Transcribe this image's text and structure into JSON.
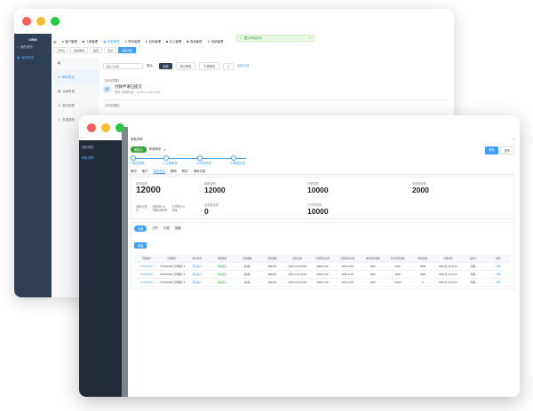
{
  "colors": {
    "red": "#ff5f57",
    "yellow": "#febc2e",
    "green": "#28c840",
    "accent": "#409eff",
    "sidebar_back": "#2f3f56",
    "sidebar_front": "#222b38"
  },
  "back": {
    "brand": "CRM",
    "side_items": [
      {
        "icon": "home-icon",
        "label": "我的首页"
      },
      {
        "icon": "grid-icon",
        "label": "我的审批"
      }
    ],
    "topnav": [
      {
        "icon": "user-icon",
        "label": "客户管理"
      },
      {
        "icon": "doc-icon",
        "label": "工单管理"
      },
      {
        "icon": "check-icon",
        "label": "审批管理"
      },
      {
        "icon": "chart-icon",
        "label": "财务管理"
      },
      {
        "icon": "target-icon",
        "label": "目标管理"
      },
      {
        "icon": "book-icon",
        "label": "办公管理"
      },
      {
        "icon": "box-icon",
        "label": "商品管理"
      },
      {
        "icon": "search-icon",
        "label": "系统管理"
      }
    ],
    "tags": [
      "工作台",
      "我的审批",
      "首页",
      "待办",
      "审批详情"
    ],
    "toast": "提交审批成功",
    "sub_head": "4",
    "sub_items": [
      "审批提交",
      "全部审批",
      "我已处理",
      "抄送我的"
    ],
    "filter": {
      "input_placeholder": "请输入内容",
      "label": "显示：",
      "buttons": [
        "全部",
        "我已审批",
        "不需审批",
        "4"
      ],
      "link": "全部已读"
    },
    "items": [
      {
        "tag": "【审批提醒】",
        "title": "付款申请已提交",
        "meta": "审批    发起时间：2023-11-15 14:03"
      },
      {
        "tag": "【审批提醒】"
      }
    ]
  },
  "front": {
    "side_items": [
      "我的审批",
      "审批详情"
    ],
    "title": "审批详情",
    "status_badge": "审批中",
    "applicant": "申请单号",
    "actions": [
      "审批",
      "更多"
    ],
    "steps": [
      {
        "label": "①提交审批"
      },
      {
        "label": "②主管审批"
      },
      {
        "label": "③财务审批"
      },
      {
        "label": "④审批完成"
      }
    ],
    "tabs": [
      "概况",
      "客户",
      "基本信息",
      "联系",
      "附件",
      "审批记录"
    ],
    "stats": [
      {
        "label": "合同金额",
        "value": "12000"
      },
      {
        "label": "回款金额",
        "value": "12000"
      },
      {
        "label": "开票金额",
        "value": "10000"
      },
      {
        "label": "未回款金额",
        "value": "2000"
      }
    ],
    "ratios": [
      {
        "label": "回款次数",
        "value": "1"
      },
      {
        "label": "回款率(%)",
        "value": "100.00%"
      },
      {
        "label": "开票率(%)",
        "value": "0%"
      }
    ],
    "stats2": [
      {
        "label": "应收款金额",
        "value": "0"
      },
      {
        "label": "已开票金额",
        "value": "10000"
      }
    ],
    "sub_tabs": [
      "全部",
      "已开",
      "已收",
      "回款"
    ],
    "new_button": "新建",
    "table": {
      "headers": [
        "回款编号",
        "合同编号",
        "客户名称",
        "审批状态",
        "回款期数",
        "回款金额",
        "回款日期",
        "计划回款日期",
        "实际回款日期",
        "本次回款金额",
        "累计回款金额",
        "剩余金额",
        "创建时间",
        "负责人",
        "操作"
      ],
      "rows": [
        [
          "HK2023001",
          "HT20231115 合同编号 001",
          "测试客户",
          "审批通过",
          "第1期",
          "4000.00",
          "2023-11-15 09:30",
          "2023-11-15",
          "2023-11-15",
          "4000",
          "4000",
          "8000",
          "2023-11-15 10:21",
          "张丽",
          "详情"
        ],
        [
          "HK2023002",
          "HT20231115 合同编号 001",
          "测试客户",
          "审批通过",
          "第2期",
          "4000.00",
          "2023-11-15 09:31",
          "2023-11-16",
          "2023-11-15",
          "4000",
          "8000",
          "4000",
          "2023-11-15 10:22",
          "张丽",
          "详情"
        ],
        [
          "HK2023003",
          "HT20231115 合同编号 001",
          "测试客户",
          "审批通过",
          "第3期",
          "4000.00",
          "2023-11-15 09:32",
          "2023-11-18",
          "2023-11-18",
          "4000",
          "12000",
          "0",
          "2023-11-15 10:23",
          "张丽",
          "详情"
        ]
      ]
    }
  }
}
